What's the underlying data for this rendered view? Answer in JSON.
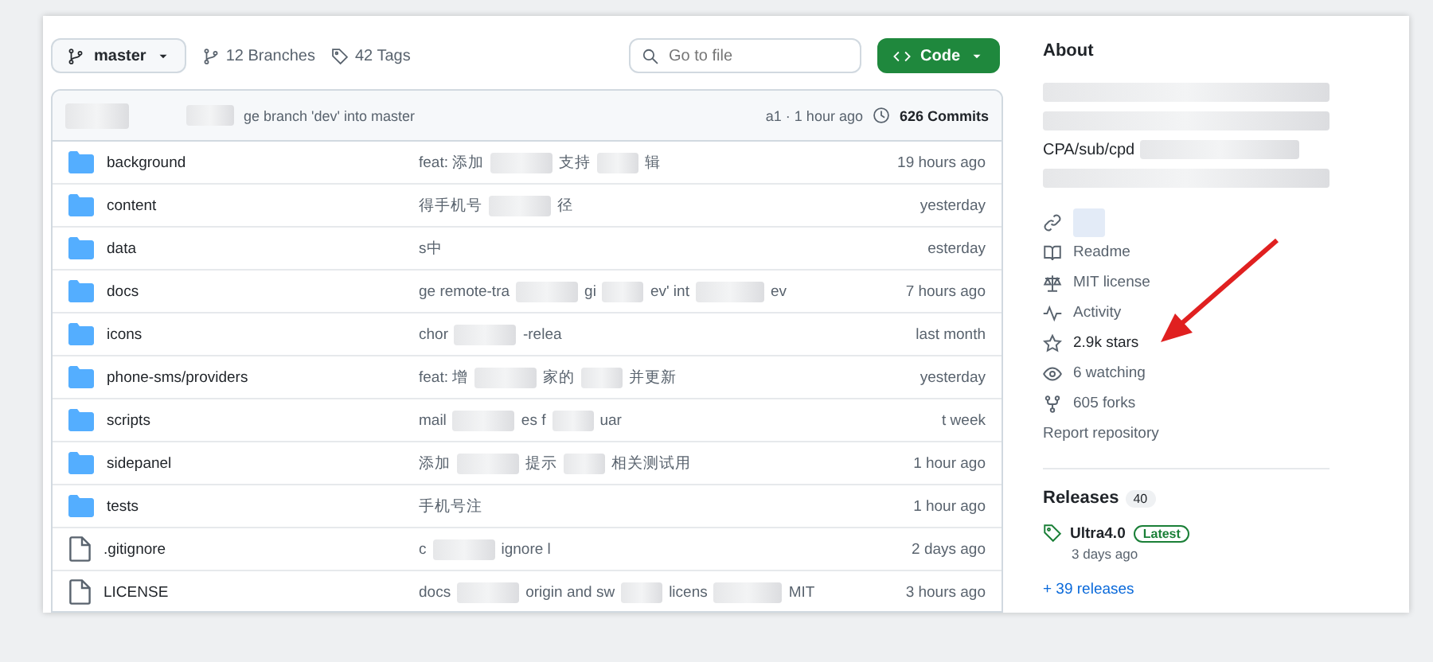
{
  "toolbar": {
    "branch": "master",
    "branches": "12 Branches",
    "tags": "42 Tags",
    "search": {
      "placeholder": "Go to file"
    },
    "code_button": "Code"
  },
  "latest_commit": {
    "message": "ge branch 'dev' into master",
    "meta": "a1 · 1 hour ago",
    "commits": "626 Commits"
  },
  "files": [
    {
      "kind": "folder",
      "name": "background",
      "message_parts": [
        "feat: 添加",
        "支持",
        "辑"
      ],
      "time": "19 hours ago"
    },
    {
      "kind": "folder",
      "name": "content",
      "message_parts": [
        "得手机号",
        "径"
      ],
      "time": "yesterday"
    },
    {
      "kind": "folder",
      "name": "data",
      "message_parts": [
        "s中"
      ],
      "time": "esterday"
    },
    {
      "kind": "folder",
      "name": "docs",
      "message_parts": [
        "ge remote-tra",
        "gi",
        "ev' int",
        "ev"
      ],
      "time": "7 hours ago"
    },
    {
      "kind": "folder",
      "name": "icons",
      "message_parts": [
        "chor",
        "-relea"
      ],
      "time": "last month"
    },
    {
      "kind": "folder",
      "name": "phone-sms/providers",
      "message_parts": [
        "feat: 增",
        "家的",
        "并更新"
      ],
      "time": "yesterday"
    },
    {
      "kind": "folder",
      "name": "scripts",
      "message_parts": [
        "mail",
        "es f",
        "uar"
      ],
      "time": "t week"
    },
    {
      "kind": "folder",
      "name": "sidepanel",
      "message_parts": [
        "添加",
        "提示",
        "相关测试用"
      ],
      "time": "1 hour ago"
    },
    {
      "kind": "folder",
      "name": "tests",
      "message_parts": [
        "手机号注"
      ],
      "time": "1 hour ago"
    },
    {
      "kind": "file",
      "name": ".gitignore",
      "message_parts": [
        "c",
        "ignore l"
      ],
      "time": "2 days ago"
    },
    {
      "kind": "file",
      "name": "LICENSE",
      "message_parts": [
        "docs",
        "origin and sw",
        "licens",
        "MIT"
      ],
      "time": "3 hours ago"
    }
  ],
  "about": {
    "title": "About",
    "description": "CPA/sub/cpd",
    "items": [
      {
        "kind": "readme",
        "label": "Readme"
      },
      {
        "kind": "license",
        "label": "MIT license"
      },
      {
        "kind": "activity",
        "label": "Activity"
      },
      {
        "kind": "stars",
        "label": "2.9k stars"
      },
      {
        "kind": "watching",
        "label": "6 watching"
      },
      {
        "kind": "forks",
        "label": "605 forks"
      }
    ],
    "report": "Report repository"
  },
  "releases": {
    "title": "Releases",
    "count": "40",
    "latest": {
      "name": "Ultra4.0",
      "badge": "Latest",
      "date": "3 days ago"
    },
    "more": "+ 39 releases"
  }
}
